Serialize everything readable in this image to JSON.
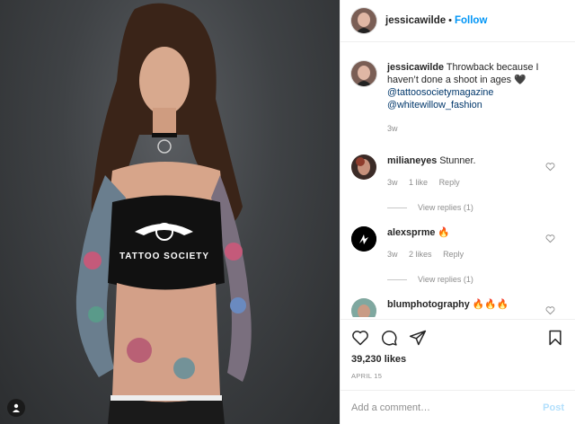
{
  "post": {
    "author": "jessicawilde",
    "dot": "•",
    "follow_label": "Follow",
    "caption": {
      "username": "jessicawilde",
      "text": "Throwback because I haven’t done a shoot in ages 🖤",
      "mention1": "@tattoosocietymagazine",
      "mention2": "@whitewillow_fashion",
      "age": "3w"
    },
    "comments": [
      {
        "username": "milianeyes",
        "text": "Stunner.",
        "age": "3w",
        "likes": "1 like",
        "reply_label": "Reply",
        "view_replies": "View replies (1)"
      },
      {
        "username": "alexsprme",
        "text": "🔥",
        "age": "3w",
        "likes": "2 likes",
        "reply_label": "Reply",
        "view_replies": "View replies (1)"
      },
      {
        "username": "blumphotography",
        "text": "🔥🔥🔥"
      }
    ],
    "likes_count": "39,230 likes",
    "date": "APRIL 15",
    "add_comment_placeholder": "Add a comment…",
    "post_label": "Post",
    "shirt_text": "TATTOO SOCIETY"
  },
  "icons": {
    "like": "heart-icon",
    "comment": "comment-icon",
    "share": "paper-plane-icon",
    "save": "bookmark-icon",
    "tag": "user-tag-icon"
  },
  "colors": {
    "accent": "#0095f6",
    "link": "#00376b",
    "muted": "#8e8e8e"
  }
}
